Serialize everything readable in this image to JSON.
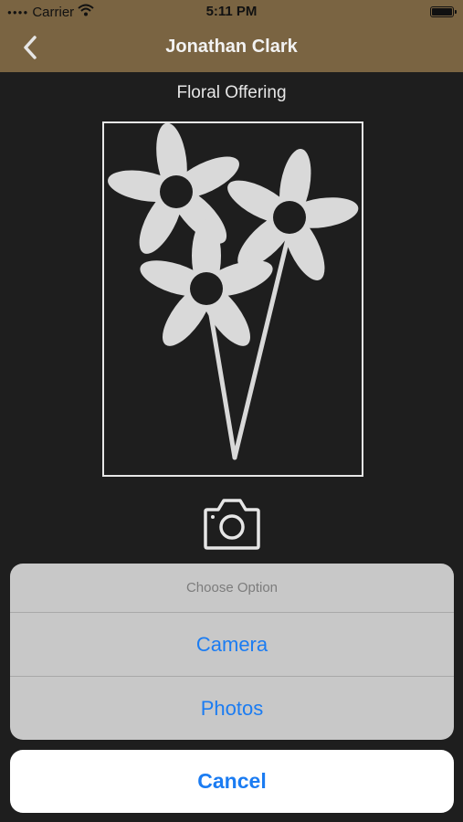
{
  "status_bar": {
    "carrier": "Carrier",
    "time": "5:11 PM"
  },
  "nav": {
    "title": "Jonathan Clark",
    "back_icon": "chevron-left-icon"
  },
  "page": {
    "subtitle": "Floral Offering",
    "image_icon": "flower-bouquet-icon",
    "camera_icon": "camera-icon"
  },
  "action_sheet": {
    "title": "Choose Option",
    "options": [
      {
        "label": "Camera"
      },
      {
        "label": "Photos"
      }
    ],
    "cancel_label": "Cancel"
  },
  "colors": {
    "nav_background": "#7a6442",
    "page_background": "#1e1e1e",
    "action_blue": "#1b7cf2",
    "sheet_background": "#c8c8c8"
  }
}
